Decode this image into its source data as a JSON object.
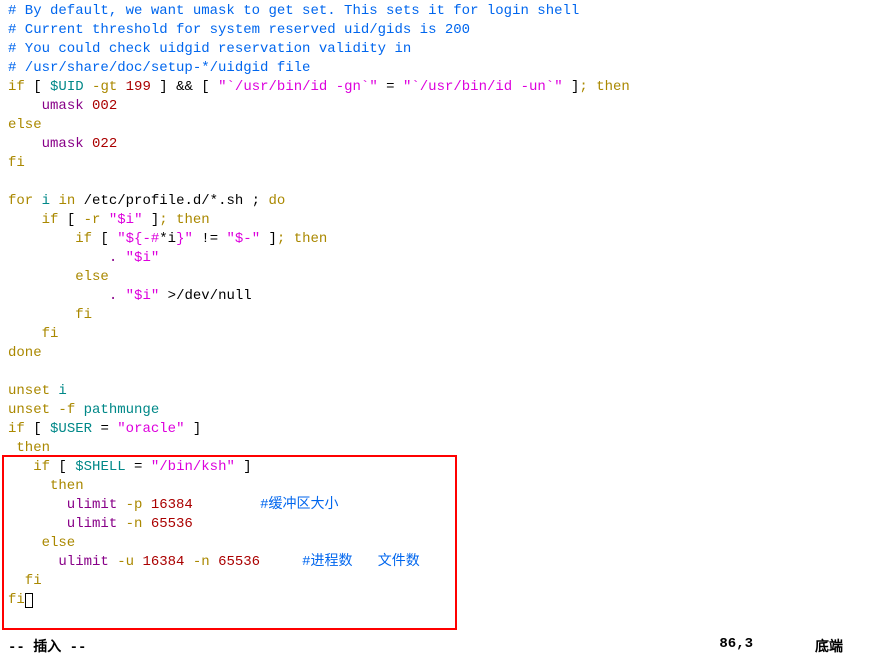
{
  "lines": {
    "l0": "# By default, we want umask to get set. This sets it for login shell",
    "l1": "# Current threshold for system reserved uid/gids is 200",
    "l2": "# You could check uidgid reservation validity in",
    "l3": "# /usr/share/doc/setup-*/uidgid file",
    "l4_if": "if",
    "l4_lb": " [ ",
    "l4_uid": "$UID",
    "l4_gt": " -gt ",
    "l4_num": "199",
    "l4_rb": " ]",
    "l4_and": " && ",
    "l4_lb2": "[ ",
    "l4_s1": "\"`/usr/bin/id -gn`\"",
    "l4_eq": " = ",
    "l4_s2": "\"`/usr/bin/id -un`\"",
    "l4_rb2": " ]",
    "l4_then": "; then",
    "l5_indent": "    ",
    "l5_cmd": "umask",
    "l5_sp": " ",
    "l5_val": "002",
    "l6_else": "else",
    "l7_cmd": "umask",
    "l7_val": "022",
    "l8_fi": "fi",
    "l9_for": "for",
    "l9_i": " i ",
    "l9_in": "in",
    "l9_path": " /etc/profile.d/*.sh ; ",
    "l9_do": "do",
    "l10_if": "if",
    "l10_lb": " [ ",
    "l10_r": "-r ",
    "l10_s": "\"$i\"",
    "l10_rb": " ]",
    "l10_then": "; then",
    "l11_if": "if",
    "l11_lb": " [ ",
    "l11_s1a": "\"${-#",
    "l11_star": "*i",
    "l11_s1b": "}\"",
    "l11_ne": " != ",
    "l11_s2": "\"$-\"",
    "l11_rb": " ]",
    "l11_then": "; then",
    "l12_dot": ". ",
    "l12_s": "\"$i\"",
    "l13_else": "else",
    "l14_dot": ". ",
    "l14_s": "\"$i\"",
    "l14_redir": " >",
    "l14_null": "/dev/null",
    "l15_fi": "fi",
    "l16_fi": "fi",
    "l17_done": "done",
    "l18_unset": "unset",
    "l18_i": " i",
    "l19_unset": "unset",
    "l19_f": " -f ",
    "l19_func": "pathmunge",
    "l20_if": "if",
    "l20_lb": " [ ",
    "l20_user": "$USER",
    "l20_eq": " = ",
    "l20_s": "\"oracle\"",
    "l20_rb": " ]",
    "l21_then": " then",
    "l22_if": "   if",
    "l22_lb": " [ ",
    "l22_shell": "$SHELL",
    "l22_eq": " = ",
    "l22_s": "\"/bin/ksh\"",
    "l22_rb": " ]",
    "l23_then": "     then",
    "l24_cmd": "       ulimit",
    "l24_p": " -p ",
    "l24_n1": "16384",
    "l24_sp": "        ",
    "l24_c": "#缓冲区大小",
    "l25_cmd": "       ulimit",
    "l25_n": " -n ",
    "l25_n1": "65536",
    "l26_else": "    else",
    "l27_cmd": "      ulimit",
    "l27_u": " -u ",
    "l27_n1": "16384",
    "l27_n": " -n ",
    "l27_n2": "65536",
    "l27_sp": "     ",
    "l27_c": "#进程数   文件数",
    "l28_fi": "  fi",
    "l29_fi": "fi"
  },
  "status": {
    "mode": "-- 插入 --",
    "position": "86,3",
    "location": "底端"
  }
}
